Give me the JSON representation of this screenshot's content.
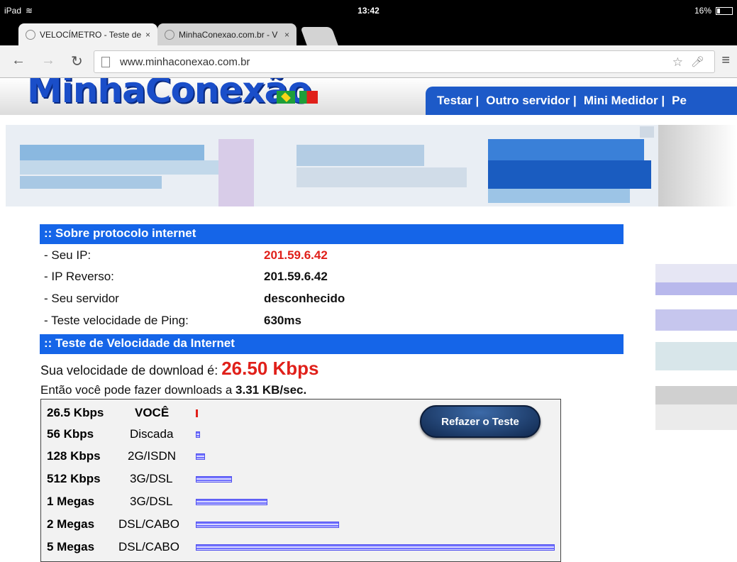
{
  "status": {
    "device": "iPad",
    "time": "13:42",
    "battery": "16%"
  },
  "tabs": [
    {
      "title": "VELOCÍMETRO - Teste de",
      "close": "×"
    },
    {
      "title": "MinhaConexao.com.br - V",
      "close": "×"
    }
  ],
  "omnibox": {
    "url": "www.minhaconexao.com.br"
  },
  "site": {
    "logo": "MinhaConexão",
    "nav": [
      "Testar |",
      "Outro servidor |",
      "Mini Medidor |",
      "Pe"
    ]
  },
  "protocol": {
    "header": ":: Sobre protocolo internet",
    "rows": [
      {
        "label": "- Seu IP:",
        "value": "201.59.6.42"
      },
      {
        "label": "- IP Reverso:",
        "value": "201.59.6.42"
      },
      {
        "label": "- Seu servidor",
        "value": "desconhecido"
      },
      {
        "label": "- Teste velocidade de Ping:",
        "value": "630ms"
      }
    ]
  },
  "speedtest": {
    "header": ":: Teste de Velocidade da Internet",
    "download_prefix": "Sua velocidade de download é:",
    "download_value": "26.50 Kbps",
    "downloads_prefix": "Então você pode fazer downloads a",
    "downloads_value": "3.31 KB/sec.",
    "redo_button": "Refazer o Teste",
    "rows": [
      {
        "speed": "26.5 Kbps",
        "type": "VOCÊ",
        "kbps": 26.5
      },
      {
        "speed": "56 Kbps",
        "type": "Discada",
        "kbps": 56
      },
      {
        "speed": "128 Kbps",
        "type": "2G/ISDN",
        "kbps": 128
      },
      {
        "speed": "512 Kbps",
        "type": "3G/DSL",
        "kbps": 512
      },
      {
        "speed": "1 Megas",
        "type": "3G/DSL",
        "kbps": 1024
      },
      {
        "speed": "2 Megas",
        "type": "DSL/CABO",
        "kbps": 2048
      },
      {
        "speed": "5 Megas",
        "type": "DSL/CABO",
        "kbps": 5120
      }
    ]
  },
  "colors": {
    "accent_blue": "#1565e8",
    "alert_red": "#e0201a"
  }
}
